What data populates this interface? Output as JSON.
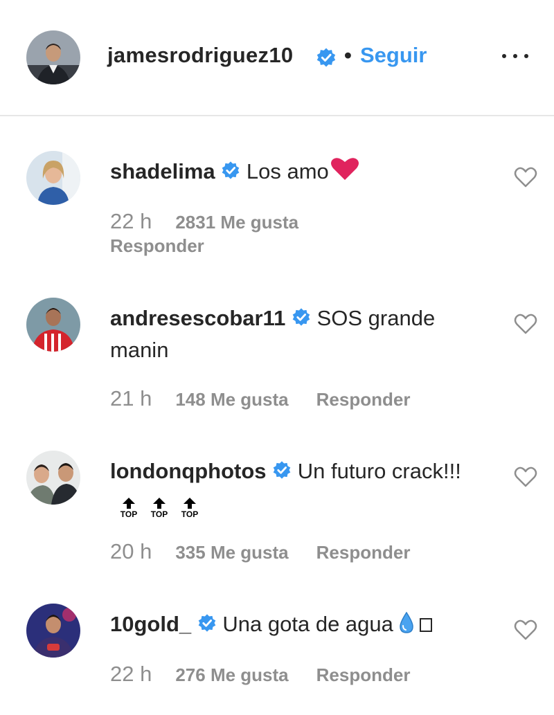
{
  "post": {
    "author": "jamesrodriguez10",
    "separator": "•",
    "follow_label": "Seguir",
    "more_icon": "more-horizontal-icon"
  },
  "colors": {
    "link": "#3897f0",
    "verified": "#3897f0",
    "muted": "#8e8e8e",
    "text": "#262626",
    "emoji_heart": "#e0245e",
    "droplet": "#4aa3f0"
  },
  "comments": [
    {
      "username": "shadelima",
      "text": "Los amo",
      "emoji": "red-heart-emoji",
      "time": "22 h",
      "likes": "2831 Me gusta",
      "reply": "Responder"
    },
    {
      "username": "andresescobar11",
      "text": "SOS grande manin",
      "time": "21 h",
      "likes": "148 Me gusta",
      "reply": "Responder"
    },
    {
      "username": "londonqphotos",
      "text": "Un futuro crack!!!",
      "emoji_label": "TOP",
      "emoji": "top-arrow-emoji",
      "time": "20 h",
      "likes": "335 Me gusta",
      "reply": "Responder"
    },
    {
      "username": "10gold_",
      "text": "Una gota de agua",
      "emoji": "droplet-emoji",
      "time": "22 h",
      "likes": "276 Me gusta",
      "reply": "Responder"
    }
  ]
}
